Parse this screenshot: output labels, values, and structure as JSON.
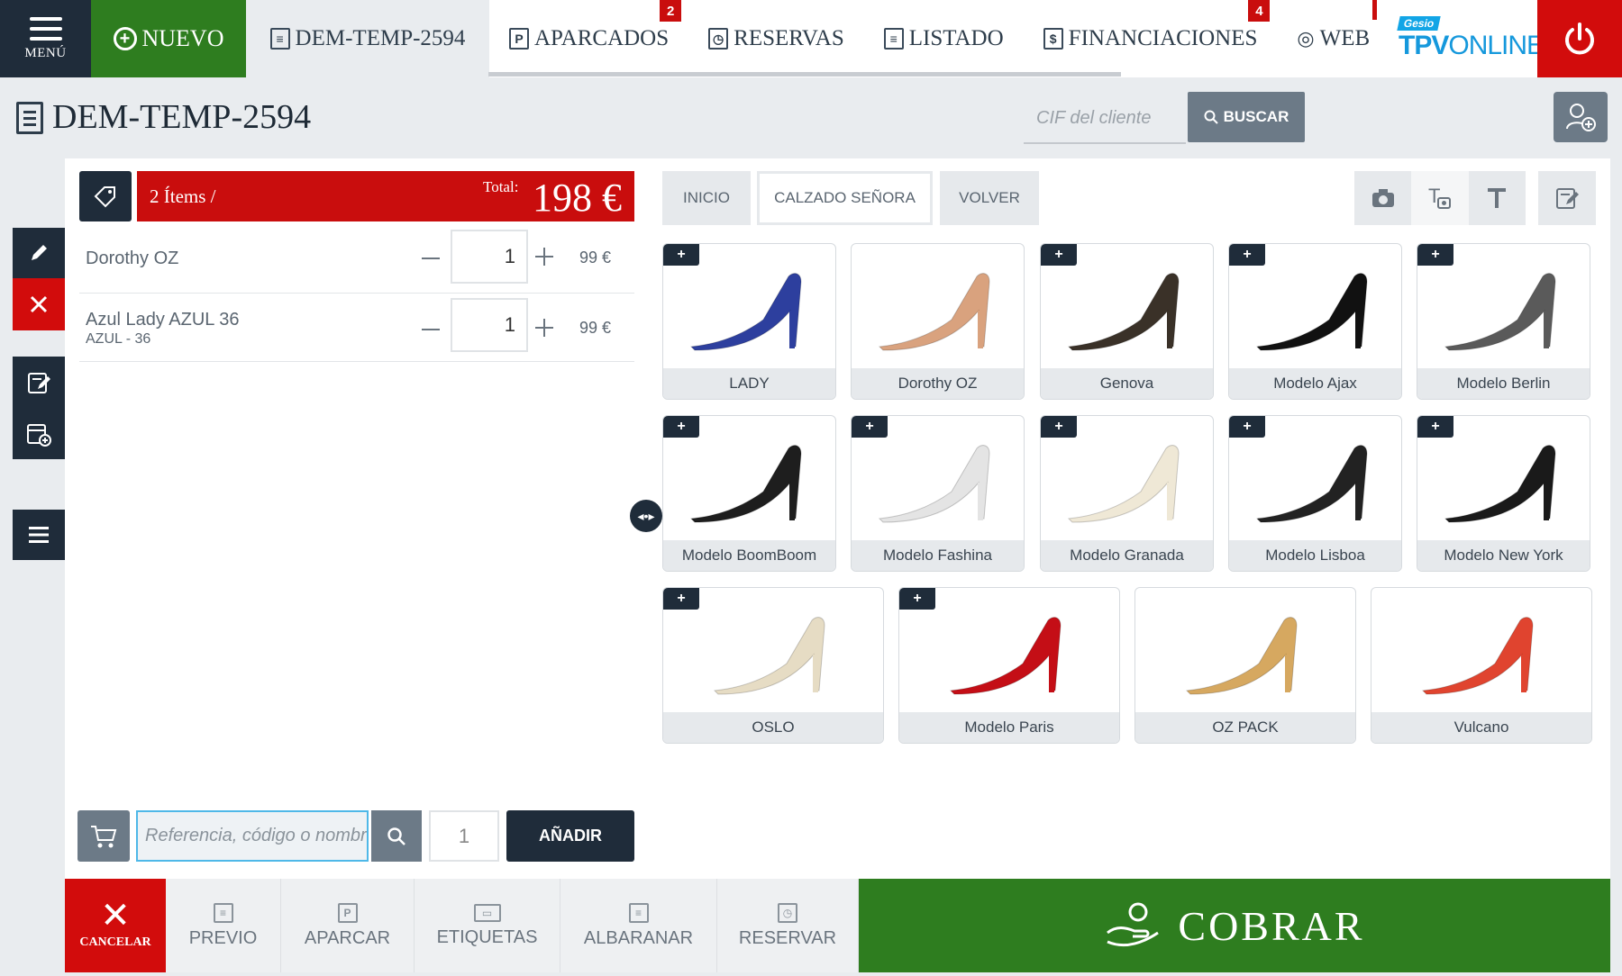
{
  "nav": {
    "menu_label": "MENÚ",
    "nuevo_label": "NUEVO",
    "tabs": [
      {
        "label": "DEM-TEMP-2594",
        "icon": "document-icon"
      },
      {
        "label": "APARCADOS",
        "icon": "parking-icon",
        "badge": "2"
      },
      {
        "label": "RESERVAS",
        "icon": "reservation-icon"
      },
      {
        "label": "LISTADO",
        "icon": "list-icon"
      },
      {
        "label": "FINANCIACIONES",
        "icon": "financing-icon",
        "badge": "4"
      },
      {
        "label": "WEB",
        "icon": "www-icon"
      }
    ],
    "brand_small": "Gesio",
    "brand_bold": "TPV",
    "brand_light": "ONLINE"
  },
  "header": {
    "title": "DEM-TEMP-2594",
    "cif_placeholder": "CIF del cliente",
    "search_label": "BUSCAR"
  },
  "cart": {
    "items_label": "2 Ítems /",
    "total_label": "Total:",
    "total_value": "198 €",
    "lines": [
      {
        "name": "Dorothy OZ",
        "variant": "",
        "qty": "1",
        "price": "99 €"
      },
      {
        "name": "Azul Lady AZUL 36",
        "variant": "AZUL - 36",
        "qty": "1",
        "price": "99 €"
      }
    ]
  },
  "add_bar": {
    "placeholder": "Referencia, código o nombre",
    "qty": "1",
    "add_label": "AÑADIR"
  },
  "categories": {
    "home": "INICIO",
    "current": "CALZADO SEÑORA",
    "back": "VOLVER"
  },
  "products": [
    {
      "name": "LADY",
      "color": "#2d3f9e",
      "addable": true
    },
    {
      "name": "Dorothy OZ",
      "color": "#d9a27e",
      "addable": false
    },
    {
      "name": "Genova",
      "color": "#3a3128",
      "addable": true
    },
    {
      "name": "Modelo Ajax",
      "color": "#111111",
      "addable": true
    },
    {
      "name": "Modelo Berlin",
      "color": "#5a5a5a",
      "addable": true
    },
    {
      "name": "Modelo BoomBoom",
      "color": "#1e1e1e",
      "addable": true
    },
    {
      "name": "Modelo Fashina",
      "color": "#e4e4e4",
      "addable": true
    },
    {
      "name": "Modelo Granada",
      "color": "#efe8d6",
      "addable": true
    },
    {
      "name": "Modelo Lisboa",
      "color": "#222222",
      "addable": true
    },
    {
      "name": "Modelo New York",
      "color": "#1a1a1a",
      "addable": true
    },
    {
      "name": "OSLO",
      "color": "#e6dcc4",
      "addable": true
    },
    {
      "name": "Modelo Paris",
      "color": "#c40e16",
      "addable": true
    },
    {
      "name": "OZ PACK",
      "color": "#d6a860",
      "addable": false
    },
    {
      "name": "Vulcano",
      "color": "#e0442f",
      "addable": false
    }
  ],
  "bottom": {
    "cancel": "CANCELAR",
    "previo": "PREVIO",
    "aparcar": "APARCAR",
    "etiquetas": "ETIQUETAS",
    "albaranar": "ALBARANAR",
    "reservar": "RESERVAR",
    "cobrar": "COBRAR"
  }
}
